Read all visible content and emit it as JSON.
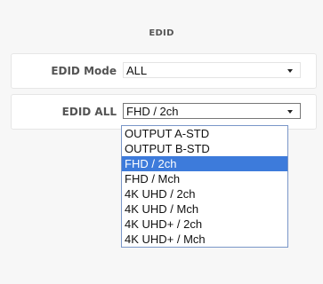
{
  "section": {
    "title": "EDID"
  },
  "edid_mode": {
    "label": "EDID Mode",
    "value": "ALL"
  },
  "edid_all": {
    "label": "EDID ALL",
    "value": "FHD / 2ch",
    "options": [
      "OUTPUT A-STD",
      "OUTPUT B-STD",
      "FHD / 2ch",
      "FHD / Mch",
      "4K UHD / 2ch",
      "4K UHD / Mch",
      "4K UHD+ / 2ch",
      "4K UHD+ / Mch"
    ],
    "selected_index": 2
  },
  "colors": {
    "selected_bg": "#3d7bdb",
    "dropdown_border": "#7a96c8"
  }
}
